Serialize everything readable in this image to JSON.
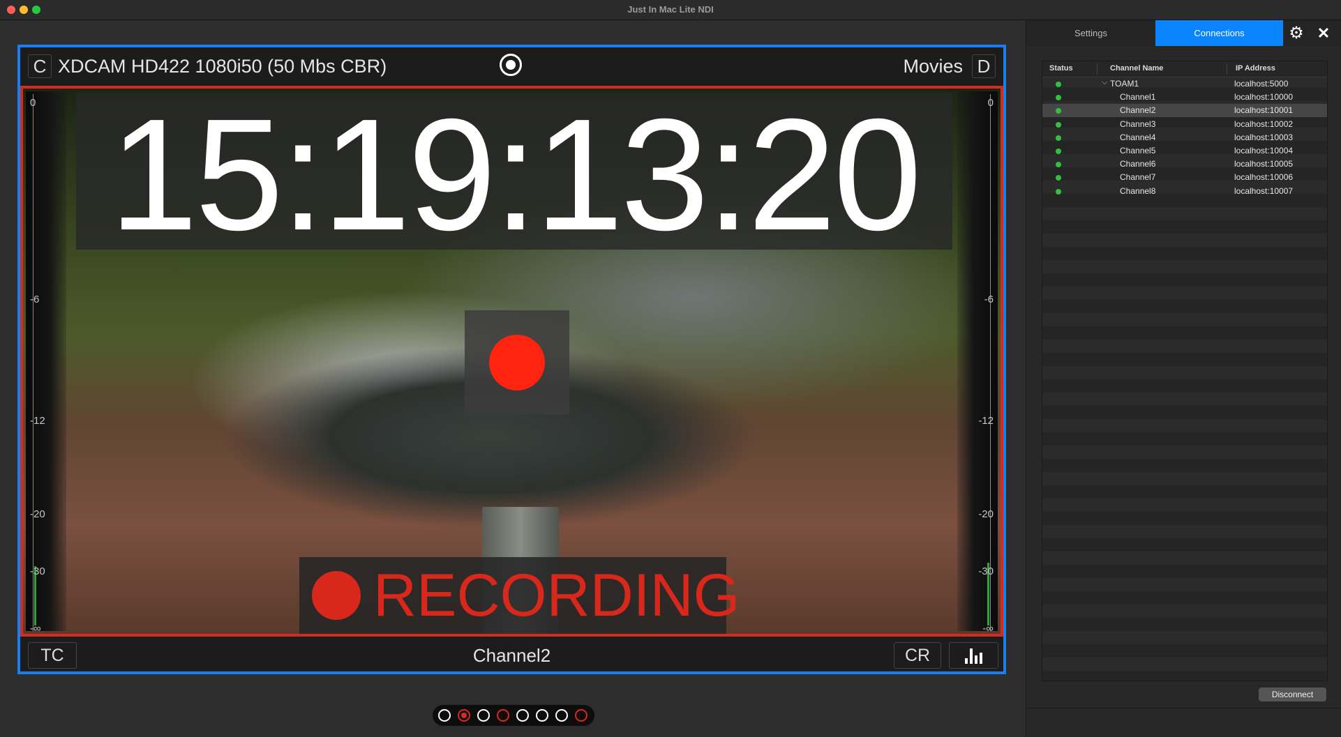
{
  "window": {
    "title": "Just In Mac Lite NDI"
  },
  "viewer": {
    "left_button": "C",
    "format": "XDCAM HD422 1080i50 (50 Mbs CBR)",
    "destination": "Movies",
    "right_button": "D",
    "timecode": "15:19:13:20",
    "recording_label": "RECORDING",
    "channel_name": "Channel2",
    "tc_button": "TC",
    "cr_button": "CR",
    "meter_left_ticks": [
      "0",
      "-6",
      "-12",
      "-20",
      "-30",
      "-∞"
    ],
    "meter_right_ticks": [
      "0",
      "-6",
      "-12",
      "-20",
      "-30",
      "-∞"
    ]
  },
  "pager": {
    "count": 8,
    "active_index": 1
  },
  "sidebar": {
    "tabs": [
      {
        "label": "Settings",
        "active": false
      },
      {
        "label": "Connections",
        "active": true
      }
    ],
    "columns": {
      "status": "Status",
      "name": "Channel Name",
      "ip": "IP Address"
    },
    "rows": [
      {
        "name": "TOAM1",
        "ip": "localhost:5000",
        "group": true
      },
      {
        "name": "Channel1",
        "ip": "localhost:10000"
      },
      {
        "name": "Channel2",
        "ip": "localhost:10001",
        "selected": true
      },
      {
        "name": "Channel3",
        "ip": "localhost:10002"
      },
      {
        "name": "Channel4",
        "ip": "localhost:10003"
      },
      {
        "name": "Channel5",
        "ip": "localhost:10004"
      },
      {
        "name": "Channel6",
        "ip": "localhost:10005"
      },
      {
        "name": "Channel7",
        "ip": "localhost:10006"
      },
      {
        "name": "Channel8",
        "ip": "localhost:10007"
      }
    ],
    "disconnect_label": "Disconnect"
  },
  "colors": {
    "accent": "#0a84ff",
    "record": "#d62a1e",
    "frame": "#1a7ef0",
    "status_ok": "#2fc339"
  }
}
